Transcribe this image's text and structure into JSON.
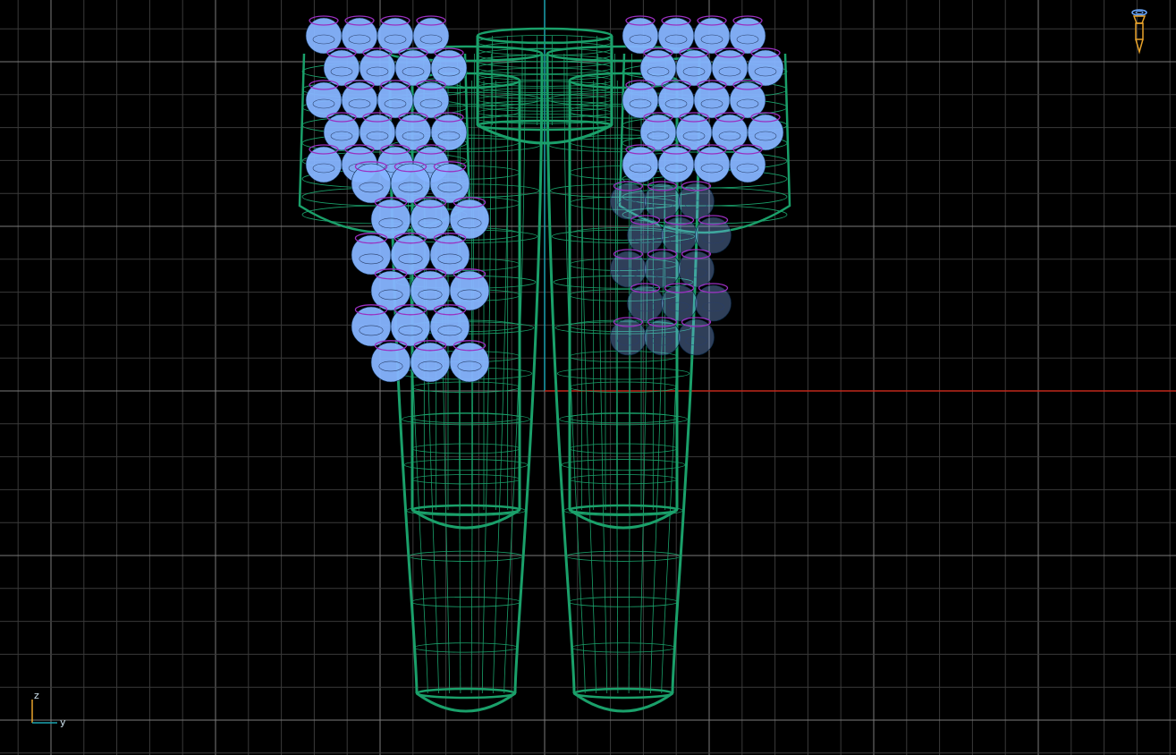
{
  "viewport": {
    "view": "front-orthographic-wireframe",
    "background_color": "#000000",
    "grid_minor_color": "#3a3a3a",
    "grid_major_color": "#7a7a7a",
    "axis_x_color": "#c0281b",
    "axis_z_color": "#1aa3b0",
    "wire_body_color": "#1aa06a",
    "wire_sphere_color": "#86b4ff",
    "wire_ring_color": "#9a2fc0"
  },
  "axis_gizmo": {
    "up_axis_label": "z",
    "side_axis_label": "y",
    "up_icon": "axis-up-icon",
    "side_icon": "axis-side-icon"
  },
  "camera_widget": {
    "icon": "camera-gizmo-icon",
    "color": "#e8a22a"
  }
}
